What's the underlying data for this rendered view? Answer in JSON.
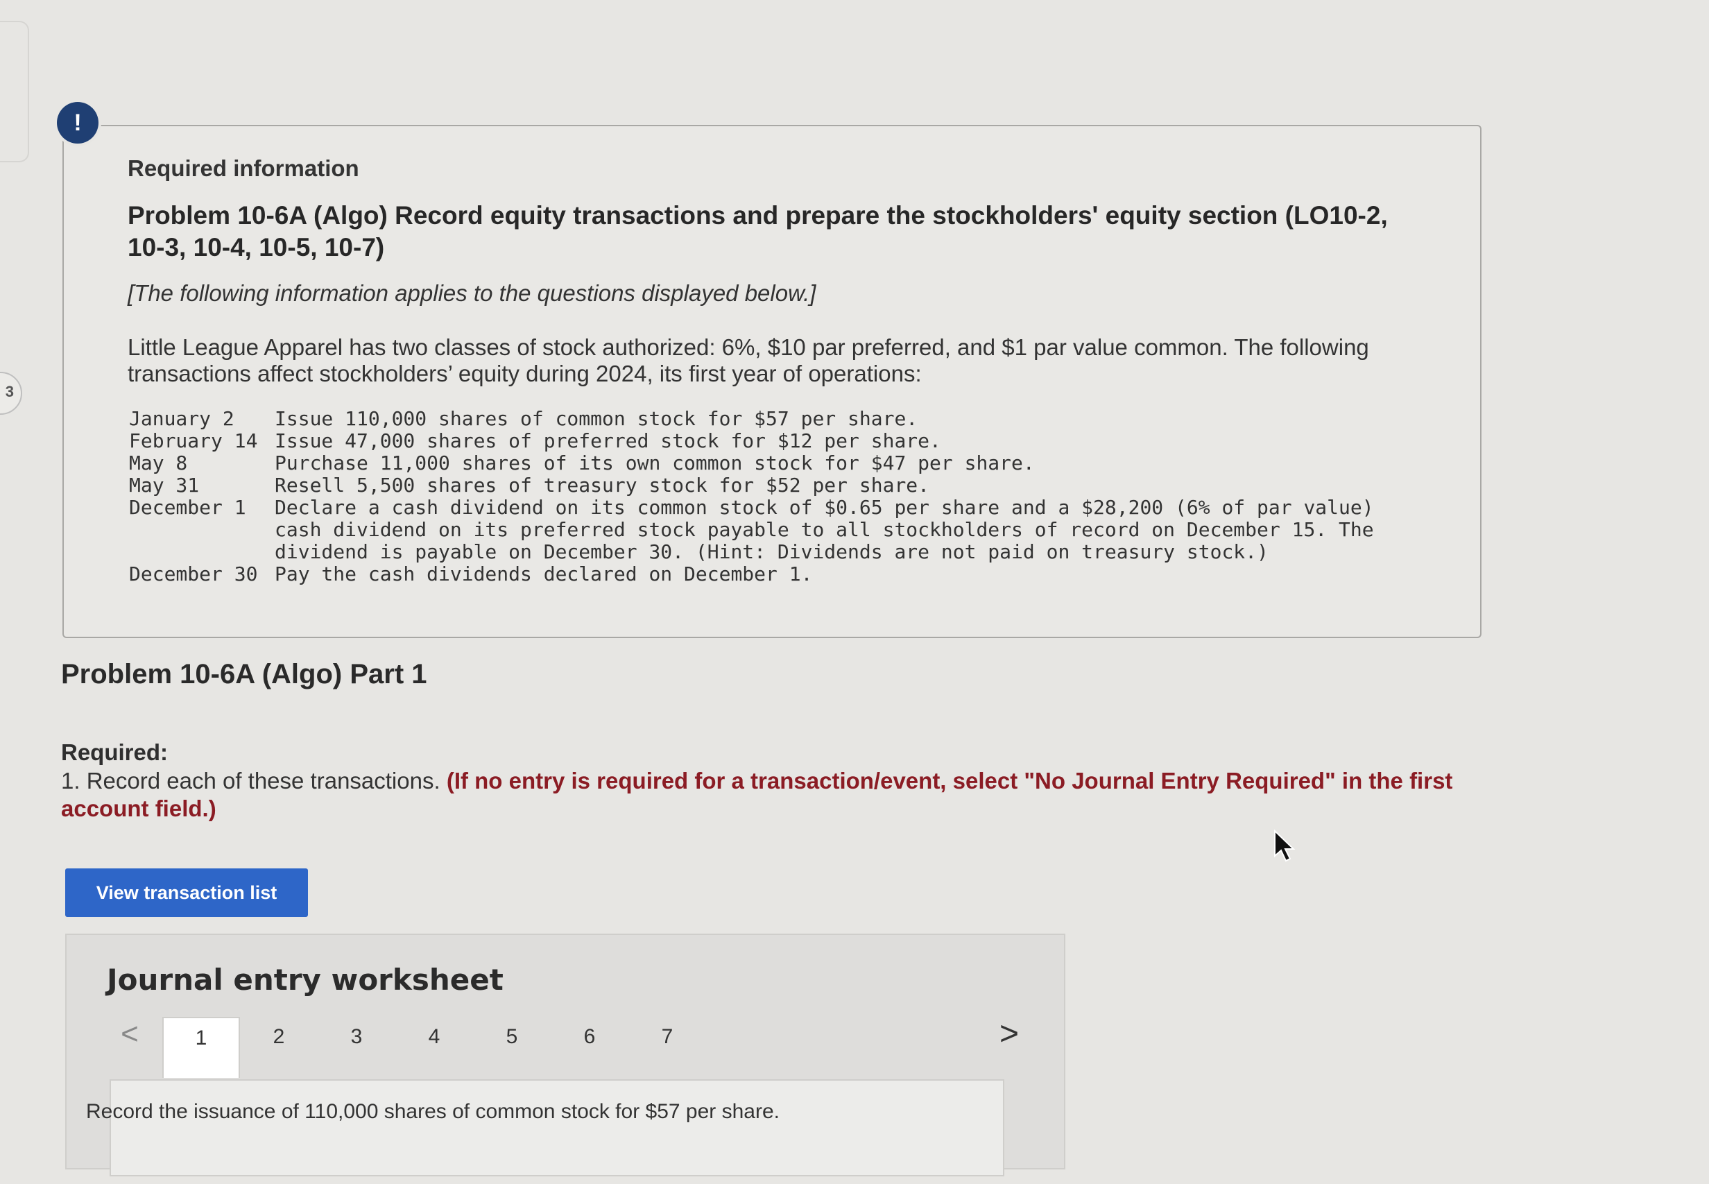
{
  "side_marker": {
    "number": "3"
  },
  "alert": {
    "symbol": "!"
  },
  "info": {
    "heading": "Required information",
    "problem_title": "Problem 10-6A (Algo) Record equity transactions and prepare the stockholders' equity section (LO10-2, 10-3, 10-4, 10-5, 10-7)",
    "note": "[The following information applies to the questions displayed below.]",
    "description": "Little League Apparel has two classes of stock authorized: 6%, $10 par preferred, and $1 par value common. The following transactions affect stockholders’ equity during 2024, its first year of operations:",
    "transactions": [
      {
        "date": "January 2",
        "text": "Issue 110,000 shares of common stock for $57 per share."
      },
      {
        "date": "February 14",
        "text": "Issue 47,000 shares of preferred stock for $12 per share."
      },
      {
        "date": "May 8",
        "text": "Purchase 11,000 shares of its own common stock for $47 per share."
      },
      {
        "date": "May 31",
        "text": "Resell 5,500 shares of treasury stock for $52 per share."
      },
      {
        "date": "December 1",
        "text": "Declare a cash dividend on its common stock of $0.65 per share and a $28,200 (6% of par value) cash dividend on its preferred stock payable to all stockholders of record on December 15. The dividend is payable on December 30. (Hint: Dividends are not paid on treasury stock.)"
      },
      {
        "date": "December 30",
        "text": "Pay the cash dividends declared on December 1."
      }
    ]
  },
  "part": {
    "title": "Problem 10-6A (Algo) Part 1",
    "required_label": "Required:",
    "required_text": "1. Record each of these transactions.",
    "required_highlight": "(If no entry is required for a transaction/event, select \"No Journal Entry Required\" in the first account field.)"
  },
  "view_button": {
    "label": "View transaction list"
  },
  "worksheet": {
    "title": "Journal entry worksheet",
    "tabs": [
      "1",
      "2",
      "3",
      "4",
      "5",
      "6",
      "7"
    ],
    "active_tab": "1",
    "prev_symbol": "<",
    "next_symbol": ">",
    "instruction": "Record the issuance of 110,000 shares of common stock for $57 per share."
  }
}
